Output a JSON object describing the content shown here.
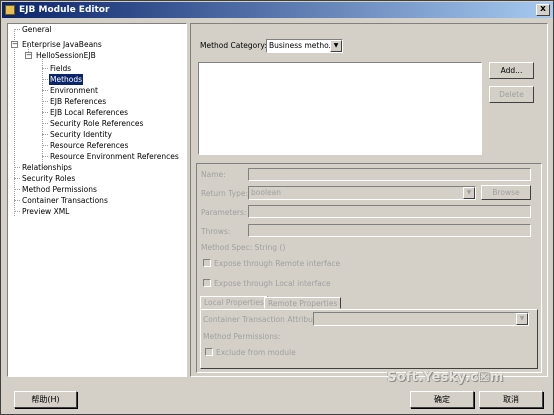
{
  "window": {
    "title": "EJB Module Editor",
    "close_glyph": "x"
  },
  "tree": {
    "items": [
      {
        "label": "General",
        "selected": false
      },
      {
        "label": "Enterprise JavaBeans",
        "selected": false,
        "expander": "−"
      },
      {
        "label": "HelloSessionEJB",
        "selected": false,
        "expander": "−"
      },
      {
        "label": "Fields",
        "selected": false
      },
      {
        "label": "Methods",
        "selected": true
      },
      {
        "label": "Environment",
        "selected": false
      },
      {
        "label": "EJB References",
        "selected": false
      },
      {
        "label": "EJB Local References",
        "selected": false
      },
      {
        "label": "Security Role References",
        "selected": false
      },
      {
        "label": "Security Identity",
        "selected": false
      },
      {
        "label": "Resource References",
        "selected": false
      },
      {
        "label": "Resource Environment References",
        "selected": false
      },
      {
        "label": "Relationships",
        "selected": false
      },
      {
        "label": "Security Roles",
        "selected": false
      },
      {
        "label": "Method Permissions",
        "selected": false
      },
      {
        "label": "Container Transactions",
        "selected": false
      },
      {
        "label": "Preview XML",
        "selected": false
      }
    ]
  },
  "methods": {
    "category_label": "Method Category:",
    "category_value": "Business metho...",
    "add_label": "Add...",
    "delete_label": "Delete",
    "name_label": "Name:",
    "return_type_label": "Return Type:",
    "return_type_value": "boolean",
    "browse_label": "Browse",
    "parameters_label": "Parameters:",
    "throws_label": "Throws:",
    "method_spec": "Method Spec:  String ()",
    "expose_remote": "Expose through Remote interface",
    "expose_local": "Expose through Local interface",
    "tabs": [
      "Local Properties",
      "Remote Properties"
    ],
    "container_tx_label": "Container Transaction Attribute:",
    "method_permissions_label": "Method Permissions:",
    "exclude_label": "Exclude from module"
  },
  "footer": {
    "help_label": "帮助(H)",
    "ok_label": "确定",
    "cancel_label": "取消"
  },
  "watermark": "Soft.Yesky.c☒m",
  "colors": {
    "selection": "#0a246a",
    "face": "#d4d0c8",
    "disabled_text": "#a0a0a0"
  }
}
